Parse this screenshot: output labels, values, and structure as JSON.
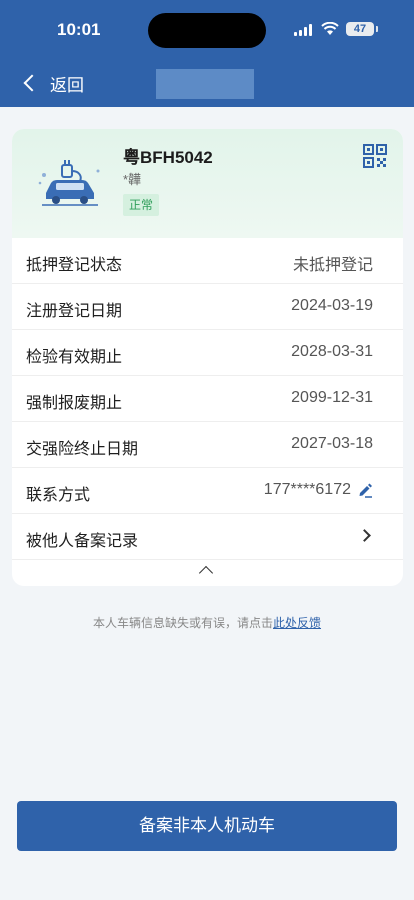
{
  "status_bar": {
    "time": "10:01",
    "battery": "47"
  },
  "nav": {
    "back_label": "返回"
  },
  "vehicle": {
    "plate": "粤BFH5042",
    "owner": "*韡",
    "status_badge": "正常"
  },
  "details": [
    {
      "label": "抵押登记状态",
      "value": "未抵押登记"
    },
    {
      "label": "注册登记日期",
      "value": "2024-03-19"
    },
    {
      "label": "检验有效期止",
      "value": "2028-03-31"
    },
    {
      "label": "强制报废期止",
      "value": "2099-12-31"
    },
    {
      "label": "交强险终止日期",
      "value": "2027-03-18"
    },
    {
      "label": "联系方式",
      "value": "177****6172"
    },
    {
      "label": "被他人备案记录",
      "value": ""
    }
  ],
  "feedback": {
    "text": "本人车辆信息缺失或有误，请点击",
    "link": "此处反馈"
  },
  "primary_button": "备案非本人机动车",
  "colors": {
    "brand": "#2f62aa",
    "status_green": "#2f9e5a",
    "card_header_bg": "#e2f4ea"
  },
  "icons": [
    "back-chevron-icon",
    "qr-code-icon",
    "car-illustration-icon",
    "edit-icon",
    "chevron-right-icon",
    "chevron-up-icon"
  ]
}
